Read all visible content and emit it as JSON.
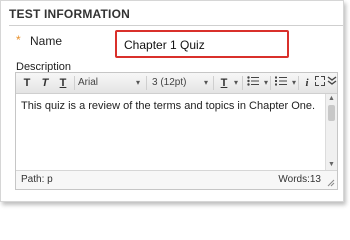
{
  "section": {
    "title": "TEST INFORMATION"
  },
  "name_field": {
    "required_marker": "*",
    "label": "Name",
    "value": "Chapter 1 Quiz"
  },
  "description": {
    "label": "Description"
  },
  "toolbar": {
    "bold_glyph": "T",
    "italic_glyph": "T",
    "underline_glyph": "T",
    "font_family": "Arial",
    "font_size": "3 (12pt)",
    "text_color_glyph": "T",
    "italic_icon_glyph": "i"
  },
  "editor": {
    "content": "This quiz is a review of the terms and topics in Chapter One.",
    "path_label": "Path: p",
    "word_count": "Words:13"
  },
  "colors": {
    "required": "#e8902c",
    "highlight_border": "#d9302b"
  }
}
